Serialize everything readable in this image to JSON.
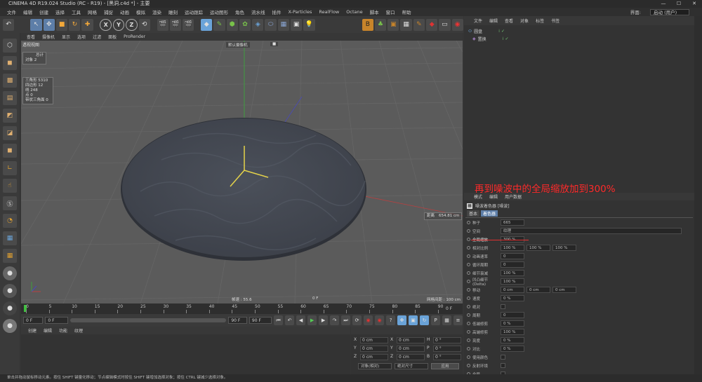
{
  "window": {
    "title": "CINEMA 4D R19.024 Studio (RC - R19) - [黑洞.c4d *] - 主要"
  },
  "menu": [
    "文件",
    "编辑",
    "创建",
    "选择",
    "工具",
    "网格",
    "捕捉",
    "动画",
    "模拟",
    "渲染",
    "雕刻",
    "运动跟踪",
    "运动图形",
    "角色",
    "流水线",
    "插件",
    "X-Particles",
    "RealFlow",
    "Octane",
    "脚本",
    "窗口",
    "帮助"
  ],
  "interface": {
    "label": "界面:",
    "value": "启动 (用户)"
  },
  "viewport": {
    "menu": [
      "查看",
      "摄像机",
      "显示",
      "选项",
      "过滤",
      "面板",
      "ProRender"
    ],
    "title": "透视视图",
    "camera_label": "默认摄像机",
    "camera_icon": "camera-icon",
    "stats_header": "总计",
    "stats_objects": "对象  2",
    "stats": [
      "三角形  5310",
      "四边形  12",
      "线  248",
      "点  0",
      "带状三角面 0"
    ],
    "distance_label": "距离",
    "distance_value": "654.81 cm",
    "grid_spacing": "网格间距 : 100 cm",
    "frame_rate": "帧速 : 55.6",
    "frame": "0 F"
  },
  "timeline": {
    "ticks": [
      "0",
      "5",
      "10",
      "15",
      "20",
      "25",
      "30",
      "35",
      "40",
      "45",
      "50",
      "55",
      "60",
      "65",
      "70",
      "75",
      "80",
      "85",
      "90"
    ],
    "end_label": "0 F"
  },
  "transport": {
    "start": "0 F",
    "current": "0 F",
    "end": "90 F",
    "max": "90 F"
  },
  "materials": {
    "menu": [
      "创建",
      "编辑",
      "功能",
      "纹理"
    ]
  },
  "coordinates": {
    "rows": [
      [
        "X",
        "0 cm",
        "X",
        "0 cm",
        "H",
        "0 °"
      ],
      [
        "Y",
        "0 cm",
        "Y",
        "0 cm",
        "P",
        "0 °"
      ],
      [
        "Z",
        "0 cm",
        "Z",
        "0 cm",
        "B",
        "0 °"
      ]
    ],
    "mode1": "对象(相对)",
    "mode2": "绝对尺寸",
    "apply": "应用"
  },
  "objects": {
    "menu": [
      "文件",
      "编辑",
      "查看",
      "对象",
      "标签",
      "书签"
    ],
    "items": [
      "圆盘",
      "置换"
    ]
  },
  "attributes": {
    "menu": [
      "模式",
      "编辑",
      "用户数据"
    ],
    "title": "噪波着色器 [噪波]",
    "tabs": [
      "基本",
      "着色器"
    ],
    "rows": [
      {
        "label": "种子",
        "v1": "665"
      },
      {
        "label": "空间",
        "v1": "纹理"
      },
      {
        "label": "全局缩放",
        "v1": "300 %"
      },
      {
        "label": "相对比例",
        "v1": "100 %",
        "v2": "100 %",
        "v3": "100 %"
      },
      {
        "label": "动画速率",
        "v1": "0"
      },
      {
        "label": "循环周期",
        "v1": "0"
      },
      {
        "label": "细节衰减",
        "v1": "100 %"
      },
      {
        "label": "凹凸细节(Delta)",
        "v1": "100 %"
      },
      {
        "label": "移动",
        "v1": "0 cm",
        "v2": "0 cm",
        "v3": "0 cm"
      },
      {
        "label": "速度",
        "v1": "0 %"
      },
      {
        "label": "绝对",
        "v1": ""
      },
      {
        "label": "周期",
        "v1": "0"
      },
      {
        "label": "低端修剪",
        "v1": "0 %"
      },
      {
        "label": "高端修剪",
        "v1": "100 %"
      },
      {
        "label": "亮度",
        "v1": "0 %"
      },
      {
        "label": "对比",
        "v1": "0 %"
      },
      {
        "label": "使用颜色",
        "v1": ""
      },
      {
        "label": "反射环境",
        "v1": ""
      },
      {
        "label": "全局",
        "v1": ""
      }
    ]
  },
  "annotation": "再到噪波中的全局缩放加到300%",
  "status": "单击并拖动鼠标移动元素。按住 SHIFT 键量化移动；节点编辑模式时按住 SHIFT 键增加选择对象；按住 CTRL 键减少选择对象。"
}
